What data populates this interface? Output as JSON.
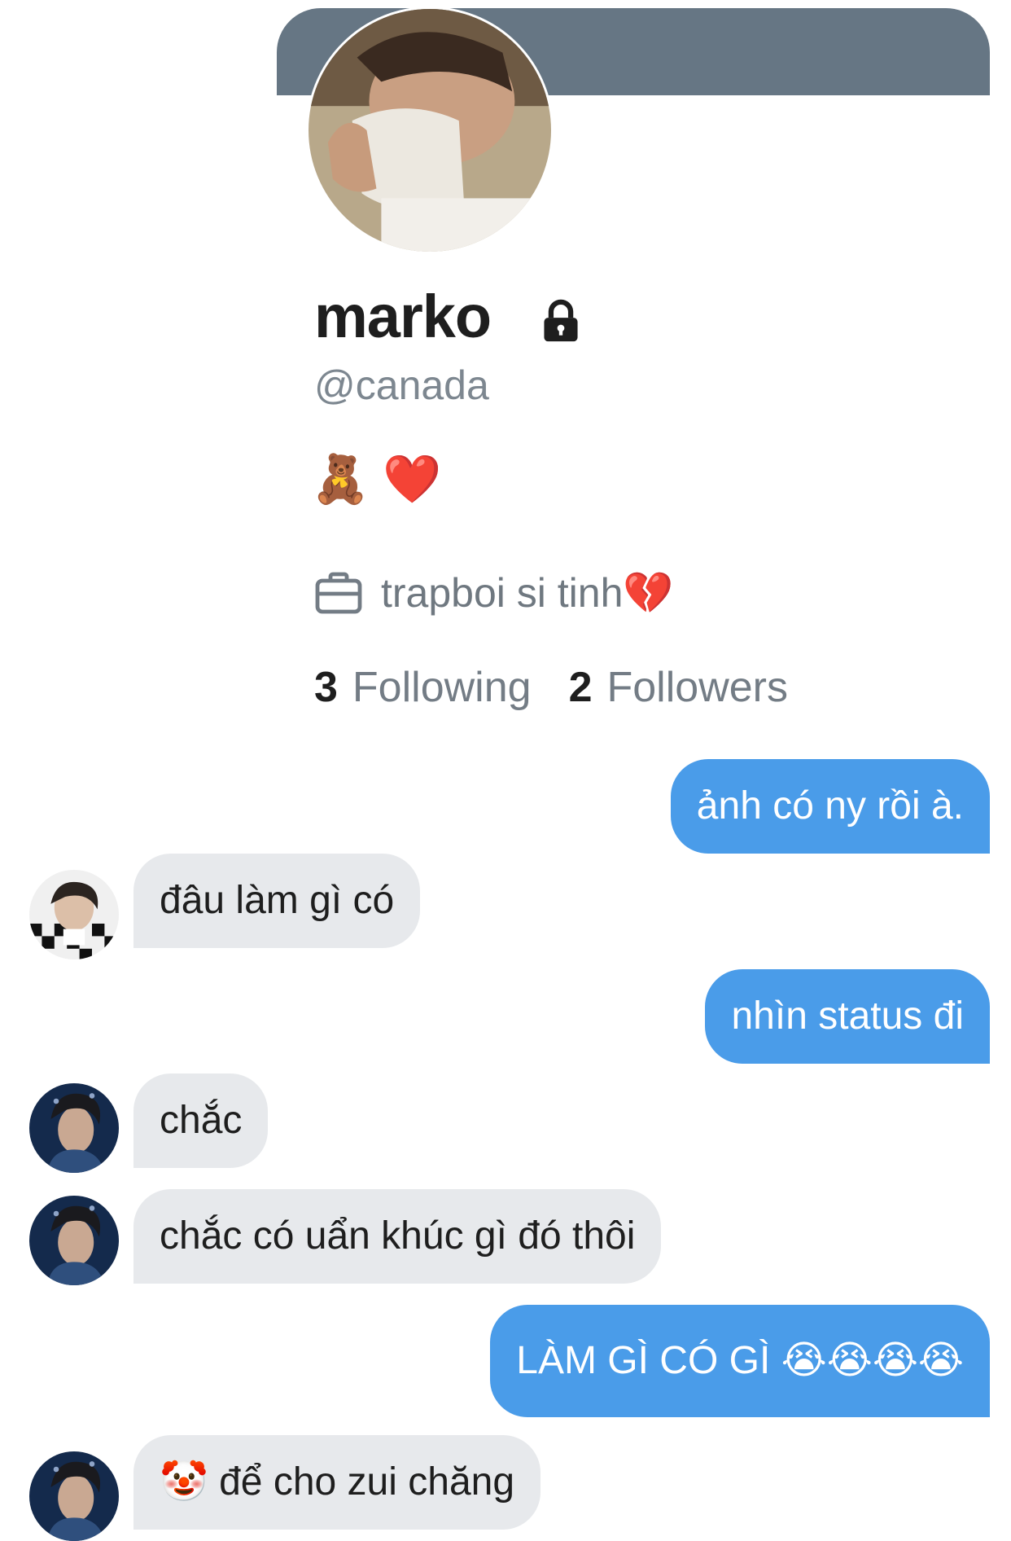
{
  "profile": {
    "display_name": "marko",
    "handle": "@canada",
    "bio": "🧸 ❤️",
    "work": "trapboi si tinh💔",
    "following_count": "3",
    "following_label": "Following",
    "followers_count": "2",
    "followers_label": "Followers",
    "banner_color": "#667684",
    "lock_icon": "lock-icon",
    "work_icon": "briefcase-icon"
  },
  "messages": [
    {
      "side": "out",
      "text": "ảnh có ny rồi à."
    },
    {
      "side": "in",
      "text": "đâu làm gì có"
    },
    {
      "side": "out",
      "text": "nhìn status đi"
    },
    {
      "side": "in",
      "text": "chắc"
    },
    {
      "side": "in",
      "text": "chắc có uẩn khúc gì đó thôi"
    },
    {
      "side": "out",
      "text": "LÀM GÌ CÓ GÌ 😭😭😭😭"
    },
    {
      "side": "in",
      "text": "🤡 để cho zui chăng"
    }
  ],
  "colors": {
    "outgoing_bubble": "#4a9ce9",
    "incoming_bubble": "#e7e9ec"
  }
}
